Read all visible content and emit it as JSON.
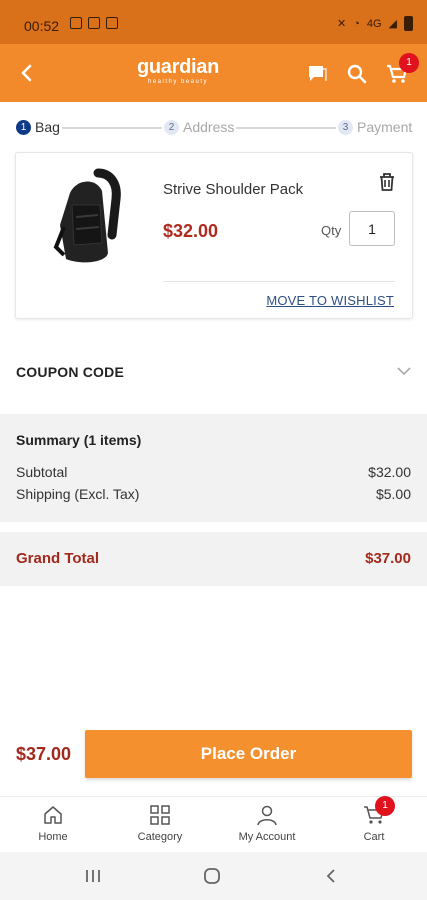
{
  "status_bar": {
    "time": "00:52",
    "signal_text": "4G"
  },
  "header": {
    "logo_name": "guardian",
    "logo_tagline": "healthy beauty",
    "cart_badge": "1",
    "brand_color": "#f28a2b"
  },
  "stepper": {
    "steps": [
      {
        "num": "1",
        "label": "Bag"
      },
      {
        "num": "2",
        "label": "Address"
      },
      {
        "num": "3",
        "label": "Payment"
      }
    ]
  },
  "cart_item": {
    "name": "Strive Shoulder Pack",
    "price": "$32.00",
    "qty_label": "Qty",
    "qty_value": "1",
    "wishlist_label": "MOVE TO WISHLIST"
  },
  "coupon": {
    "label": "COUPON CODE"
  },
  "summary": {
    "title": "Summary (1 items)",
    "subtotal_label": "Subtotal",
    "subtotal_value": "$32.00",
    "shipping_label": "Shipping (Excl. Tax)",
    "shipping_value": "$5.00",
    "grand_total_label": "Grand Total",
    "grand_total_value": "$37.00"
  },
  "order_bar": {
    "total": "$37.00",
    "place_order_label": "Place Order"
  },
  "bottom_nav": {
    "items": [
      {
        "label": "Home",
        "icon": "home-icon"
      },
      {
        "label": "Category",
        "icon": "category-icon"
      },
      {
        "label": "My Account",
        "icon": "account-icon"
      },
      {
        "label": "Cart",
        "icon": "cart-icon"
      }
    ],
    "cart_badge": "1"
  }
}
